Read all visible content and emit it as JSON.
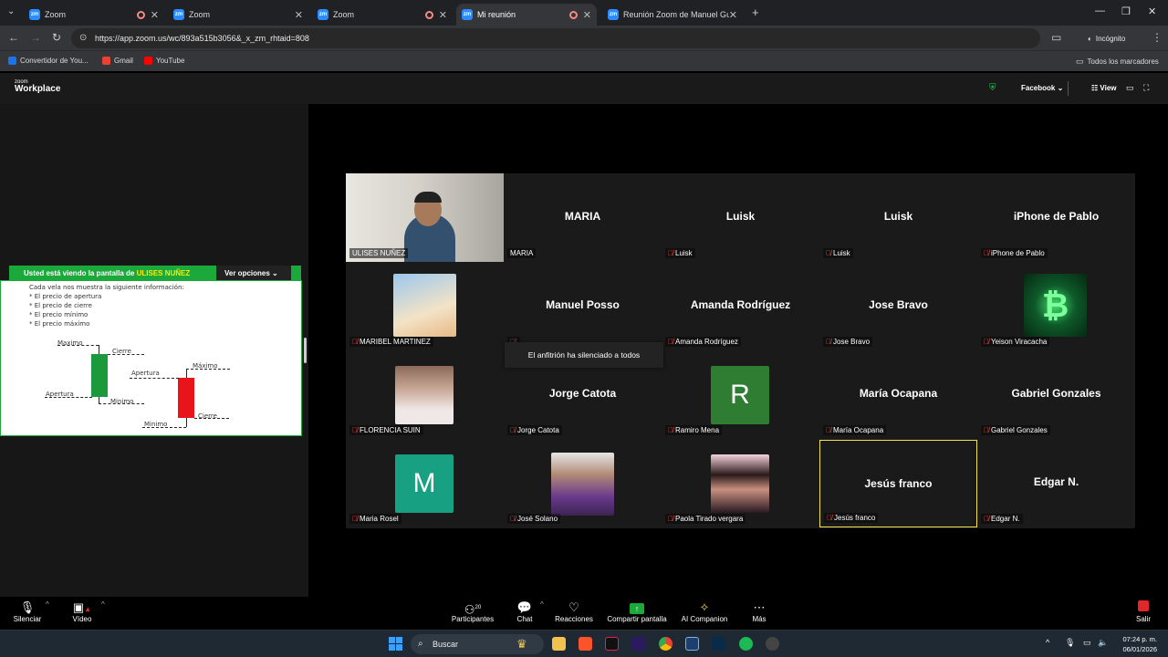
{
  "browser": {
    "tabs": [
      {
        "title": "Zoom",
        "recording": true,
        "active": false
      },
      {
        "title": "Zoom",
        "recording": false,
        "active": false
      },
      {
        "title": "Zoom",
        "recording": true,
        "active": false
      },
      {
        "title": "Mi reunión",
        "recording": true,
        "active": true
      },
      {
        "title": "Reunión Zoom de Manuel Guti",
        "recording": false,
        "active": false
      }
    ],
    "new_tab": "+",
    "url": "https://app.zoom.us/wc/893a515b3056&_x_zm_rhtaid=808",
    "incognito": "Incógnito",
    "bookmarks": [
      {
        "label": "Convertidor de You...",
        "color": "#1a73e8"
      },
      {
        "label": "Gmail",
        "color": "#ea4335"
      },
      {
        "label": "YouTube",
        "color": "#ff0000"
      }
    ],
    "all_bookmarks": "Todos los marcadores"
  },
  "zoom_header": {
    "logo_top": "zoom",
    "logo_bottom": "Workplace",
    "facebook": "Facebook",
    "view": "View"
  },
  "share": {
    "banner_prefix": "Usted está viendo la pantalla de",
    "presenter": "ULISES NUÑEZ",
    "view_options": "Ver opciones",
    "content": {
      "intro": "Cada vela nos muestra la siguiente información:",
      "bullets": [
        "* El precio de apertura",
        "* El precio de cierre",
        "* El precio mínimo",
        "* El precio máximo"
      ],
      "green_labels": [
        "Maximo",
        "Cierre",
        "Apertura",
        "Minimo"
      ],
      "red_labels": [
        "Apertura",
        "Máximo",
        "Cierre",
        "Minimo"
      ]
    }
  },
  "participants": [
    {
      "name": "ULISES NUÑEZ",
      "display": "",
      "type": "video",
      "muted": false
    },
    {
      "name": "MARIA",
      "display": "MARIA",
      "type": "name",
      "muted": false
    },
    {
      "name": "Luisk",
      "display": "Luisk",
      "type": "name",
      "muted": true
    },
    {
      "name": "Luisk",
      "display": "Luisk",
      "type": "name",
      "muted": true
    },
    {
      "name": "iPhone de Pablo",
      "display": "iPhone de Pablo",
      "type": "name",
      "muted": true
    },
    {
      "name": "MARIBEL MARTINEZ",
      "display": "",
      "type": "photo",
      "color": "#b6d6f2",
      "muted": true
    },
    {
      "name": "",
      "display": "Manuel Posso",
      "type": "name",
      "muted": true
    },
    {
      "name": "Amanda Rodríguez",
      "display": "Amanda Rodríguez",
      "type": "name",
      "muted": true
    },
    {
      "name": "Jose Bravo",
      "display": "Jose Bravo",
      "type": "name",
      "muted": true
    },
    {
      "name": "Yeison Viracacha",
      "display": "",
      "type": "photo",
      "color": "#0f3d1f",
      "muted": true
    },
    {
      "name": "FLORENCIA SUIN",
      "display": "",
      "type": "photo",
      "color": "#d9c6c0",
      "muted": true
    },
    {
      "name": "Jorge Catota",
      "display": "Jorge Catota",
      "type": "name",
      "muted": true
    },
    {
      "name": "Ramiro Mena",
      "display": "",
      "type": "letter",
      "letter": "R",
      "color": "#2e7d32",
      "muted": true
    },
    {
      "name": "María Ocapana",
      "display": "María Ocapana",
      "type": "name",
      "muted": true
    },
    {
      "name": "Gabriel Gonzales",
      "display": "Gabriel Gonzales",
      "type": "name",
      "muted": true
    },
    {
      "name": "Maria Rosel",
      "display": "",
      "type": "letter",
      "letter": "M",
      "color": "#17a081",
      "muted": true
    },
    {
      "name": "José Solano",
      "display": "",
      "type": "photo",
      "color": "#6a4a8c",
      "muted": true
    },
    {
      "name": "Paola Tirado vergara",
      "display": "",
      "type": "photo",
      "color": "#d9a0b8",
      "muted": true
    },
    {
      "name": "Jesús franco",
      "display": "Jesús franco",
      "type": "name",
      "muted": true,
      "active_speaker": true
    },
    {
      "name": "Edgar N.",
      "display": "Edgar N.",
      "type": "name",
      "muted": true
    }
  ],
  "toast": "El anfitrión ha silenciado a todos",
  "controls": {
    "mute": "Silenciar",
    "video": "Vídeo",
    "participants": "Participantes",
    "participants_count": "20",
    "chat": "Chat",
    "reactions": "Reacciones",
    "share": "Compartir pantalla",
    "ai": "AI Companion",
    "more": "Más",
    "leave": "Salir"
  },
  "taskbar": {
    "search": "Buscar",
    "time": "07:24 p. m.",
    "date": "06/01/2026"
  }
}
